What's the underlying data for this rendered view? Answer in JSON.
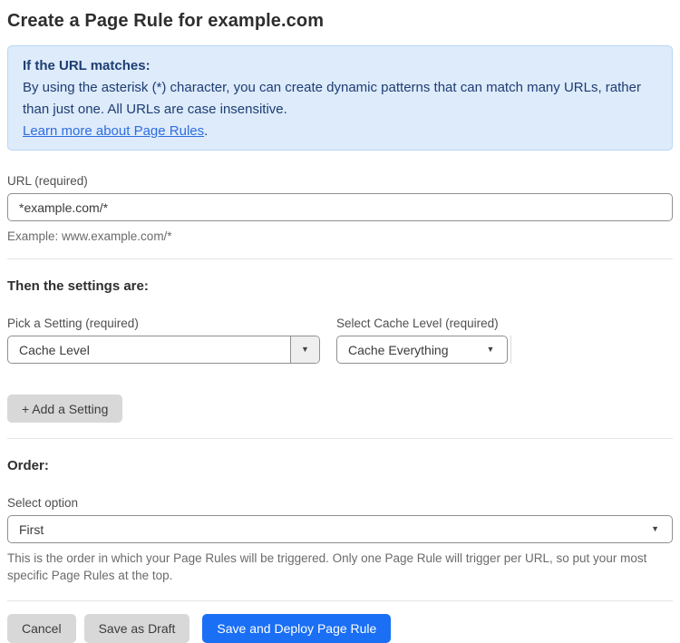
{
  "page": {
    "title": "Create a Page Rule for example.com"
  },
  "info_box": {
    "heading": "If the URL matches:",
    "body": "By using the asterisk (*) character, you can create dynamic patterns that can match many URLs, rather than just one. All URLs are case insensitive.",
    "link_label": "Learn more about Page Rules",
    "link_suffix": "."
  },
  "url_field": {
    "label": "URL (required)",
    "value": "*example.com/*",
    "helper": "Example: www.example.com/*"
  },
  "settings_section": {
    "heading": "Then the settings are:",
    "setting_picker": {
      "label": "Pick a Setting (required)",
      "value": "Cache Level"
    },
    "cache_level_picker": {
      "label": "Select Cache Level (required)",
      "value": "Cache Everything"
    },
    "add_setting_label": "+ Add a Setting"
  },
  "order_section": {
    "heading": "Order:",
    "label": "Select option",
    "value": "First",
    "helper": "This is the order in which your Page Rules will be triggered. Only one Page Rule will trigger per URL, so put your most specific Page Rules at the top."
  },
  "footer": {
    "cancel_label": "Cancel",
    "save_draft_label": "Save as Draft",
    "save_deploy_label": "Save and Deploy Page Rule"
  },
  "icons": {
    "dropdown_arrow": "▼"
  },
  "colors": {
    "accent_blue": "#1a6ff5",
    "info_bg": "#ddebfb",
    "info_border": "#b9d7f8",
    "info_text": "#1e3d72",
    "link_blue": "#2f6ddf",
    "button_gray": "#d8d8d8"
  }
}
